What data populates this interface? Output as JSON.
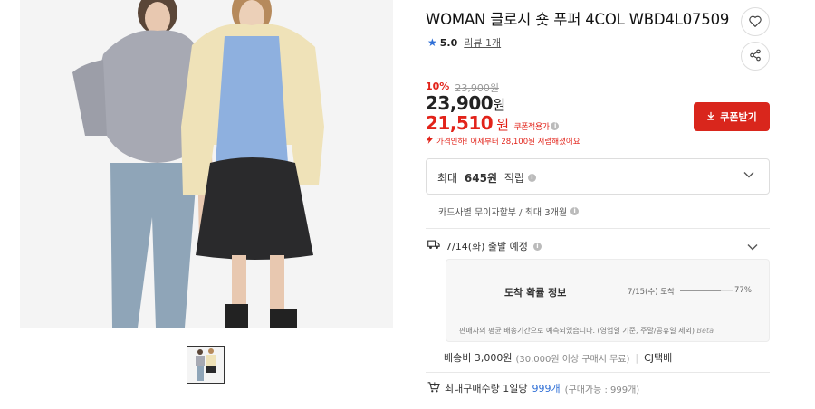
{
  "product": {
    "title": "WOMAN 글로시 숏 푸퍼 4COL WBD4L07509",
    "rating": "5.0",
    "review_label": "리뷰 1개",
    "discount_percent": "10%",
    "original_price": "23,900원",
    "price_value": "23,900",
    "price_unit": "원",
    "coupon_price_value": "21,510",
    "coupon_price_unit": "원",
    "coupon_price_label": "쿠폰적용가",
    "price_alert": "가격인하! 어제부터 28,100원 저렴해졌어요",
    "coupon_button": "쿠폰받기"
  },
  "points": {
    "prefix": "최대 ",
    "amount": "645원",
    "suffix": " 적립"
  },
  "installment": "카드사별 무이자할부 / 최대 3개월",
  "shipping": {
    "departure": "7/14(화) 출발 예정",
    "probability_title": "도착 확률 정보",
    "arrival_date": "7/15(수) 도착",
    "arrival_percent": "77%",
    "arrival_fraction": 0.77,
    "note": "판매자의 평균 배송기간으로 예측되었습니다. (영업일 기준, 주말/공휴일 제외)",
    "beta": "Beta",
    "fee": "배송비 3,000원",
    "fee_condition": "(30,000원 이상 구매시 무료)",
    "separator": "|",
    "courier": "CJ택배"
  },
  "purchase_limit": {
    "label": "최대구매수량 1일당",
    "value": "999개",
    "available": "(구매가능 : 999개)"
  },
  "colors": {
    "accent_red": "#e2231a",
    "button_red": "#d9261c",
    "link_blue": "#2f6fd6"
  },
  "icons": [
    "heart-icon",
    "share-icon",
    "star-icon",
    "info-icon",
    "download-icon",
    "chevron-down-icon",
    "truck-icon",
    "cart-icon",
    "alert-arrow-icon"
  ]
}
